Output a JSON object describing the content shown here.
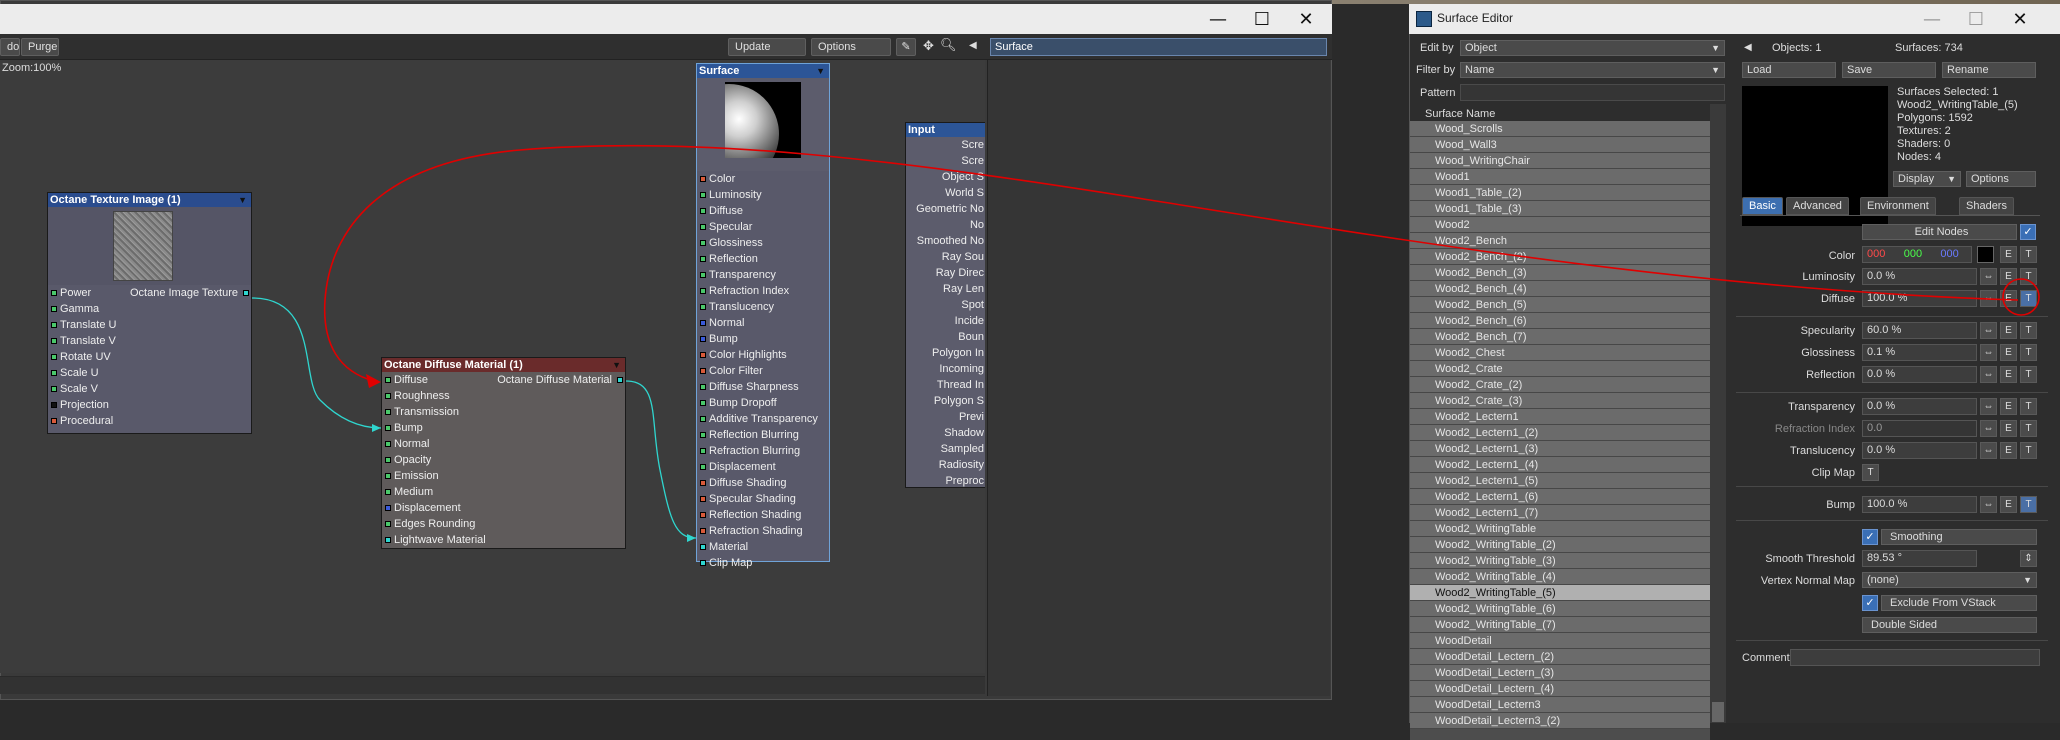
{
  "node_editor": {
    "toolbar": {
      "undo_label": "do",
      "purge_label": "Purge",
      "update_label": "Update",
      "options_label": "Options",
      "search_value": "Surface"
    },
    "zoom": "Zoom:100%",
    "texture_node": {
      "title": "Octane Texture Image (1)",
      "inputs": [
        "Power",
        "Gamma",
        "Translate U",
        "Translate V",
        "Rotate UV",
        "Scale U",
        "Scale V",
        "Projection",
        "Procedural"
      ],
      "output": "Octane Image Texture"
    },
    "diffuse_node": {
      "title": "Octane Diffuse Material (1)",
      "inputs": [
        "Diffuse",
        "Roughness",
        "Transmission",
        "Bump",
        "Normal",
        "Opacity",
        "Emission",
        "Medium",
        "Displacement",
        "Edges Rounding",
        "Lightwave Material"
      ],
      "output": "Octane Diffuse Material"
    },
    "surface_node": {
      "title": "Surface",
      "inputs": [
        "Color",
        "Luminosity",
        "Diffuse",
        "Specular",
        "Glossiness",
        "Reflection",
        "Transparency",
        "Refraction Index",
        "Translucency",
        "Normal",
        "Bump",
        "Color Highlights",
        "Color Filter",
        "Diffuse Sharpness",
        "Bump Dropoff",
        "Additive Transparency",
        "Reflection Blurring",
        "Refraction Blurring",
        "Displacement",
        "Diffuse Shading",
        "Specular Shading",
        "Reflection Shading",
        "Refraction Shading",
        "Material",
        "Clip Map"
      ]
    },
    "input_node": {
      "title": "Input",
      "outputs": [
        "Scre",
        "Scre",
        "Object S",
        "World S",
        "Geometric No",
        "No",
        "Smoothed No",
        "Ray Sou",
        "Ray Direc",
        "Ray Len",
        "Spot",
        "Incide",
        "Boun",
        "Polygon In",
        "Incoming",
        "Thread In",
        "Polygon S",
        "Previ",
        "Shadow",
        "Sampled",
        "Radiosity",
        "Preproc"
      ]
    }
  },
  "surface_editor": {
    "title": "Surface Editor",
    "edit_by_label": "Edit by",
    "edit_by_value": "Object",
    "filter_by_label": "Filter by",
    "filter_by_value": "Name",
    "pattern_label": "Pattern",
    "objects": "Objects: 1",
    "surfaces": "Surfaces: 734",
    "load": "Load",
    "save": "Save",
    "rename": "Rename",
    "info": [
      "Surfaces Selected: 1",
      "Wood2_WritingTable_(5)",
      "Polygons: 1592",
      "Textures: 2",
      "Shaders: 0",
      "Nodes: 4"
    ],
    "display": "Display",
    "options": "Options",
    "list_header": "Surface Name",
    "surfaces_list": [
      "Wood_Scrolls",
      "Wood_Wall3",
      "Wood_WritingChair",
      "Wood1",
      "Wood1_Table_(2)",
      "Wood1_Table_(3)",
      "Wood2",
      "Wood2_Bench",
      "Wood2_Bench_(2)",
      "Wood2_Bench_(3)",
      "Wood2_Bench_(4)",
      "Wood2_Bench_(5)",
      "Wood2_Bench_(6)",
      "Wood2_Bench_(7)",
      "Wood2_Chest",
      "Wood2_Crate",
      "Wood2_Crate_(2)",
      "Wood2_Crate_(3)",
      "Wood2_Lectern1",
      "Wood2_Lectern1_(2)",
      "Wood2_Lectern1_(3)",
      "Wood2_Lectern1_(4)",
      "Wood2_Lectern1_(5)",
      "Wood2_Lectern1_(6)",
      "Wood2_Lectern1_(7)",
      "Wood2_WritingTable",
      "Wood2_WritingTable_(2)",
      "Wood2_WritingTable_(3)",
      "Wood2_WritingTable_(4)",
      "Wood2_WritingTable_(5)",
      "Wood2_WritingTable_(6)",
      "Wood2_WritingTable_(7)",
      "WoodDetail",
      "WoodDetail_Lectern_(2)",
      "WoodDetail_Lectern_(3)",
      "WoodDetail_Lectern_(4)",
      "WoodDetail_Lectern3",
      "WoodDetail_Lectern3_(2)"
    ],
    "selected_surface": "Wood2_WritingTable_(5)",
    "tabs": [
      "Basic",
      "Advanced",
      "Environment",
      "Shaders"
    ],
    "edit_nodes": "Edit Nodes",
    "color_label": "Color",
    "color_r": "000",
    "color_g": "000",
    "color_b": "000",
    "luminosity_label": "Luminosity",
    "luminosity": "0.0 %",
    "diffuse_label": "Diffuse",
    "diffuse": "100.0 %",
    "specularity_label": "Specularity",
    "specularity": "60.0 %",
    "glossiness_label": "Glossiness",
    "glossiness": "0.1 %",
    "reflection_label": "Reflection",
    "reflection": "0.0 %",
    "transparency_label": "Transparency",
    "transparency": "0.0 %",
    "refraction_label": "Refraction Index",
    "refraction": "0.0",
    "translucency_label": "Translucency",
    "translucency": "0.0 %",
    "clip_map_label": "Clip Map",
    "bump_label": "Bump",
    "bump": "100.0 %",
    "smoothing": "Smoothing",
    "smooth_threshold_label": "Smooth Threshold",
    "smooth_threshold": "89.53 °",
    "vertex_normal_label": "Vertex Normal Map",
    "vertex_normal_value": "(none)",
    "exclude_vstack": "Exclude From VStack",
    "double_sided": "Double Sided",
    "comment_label": "Comment",
    "e": "E",
    "t": "T"
  },
  "colors": {
    "annotation": "#e00000",
    "wire": "#2fd6cf",
    "accent": "#3d6fb0"
  }
}
